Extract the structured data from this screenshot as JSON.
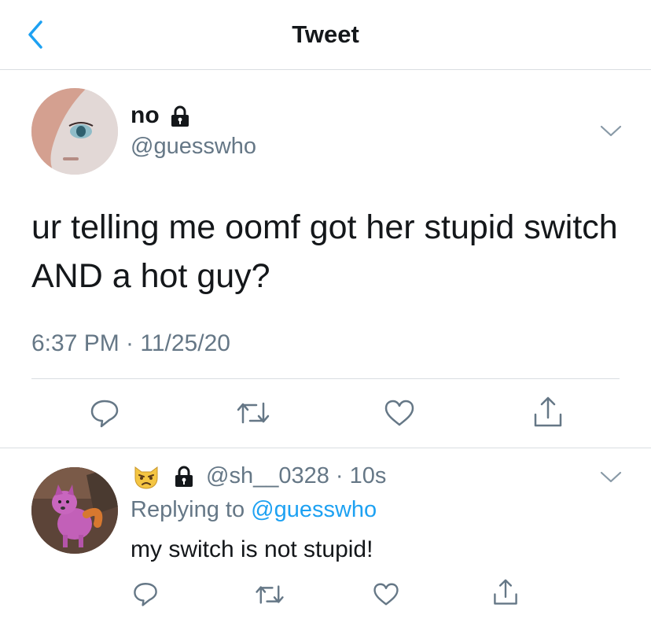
{
  "header": {
    "title": "Tweet",
    "back_icon": "chevron-left-icon",
    "accent": "#1da1f2"
  },
  "tweet": {
    "display_name": "no",
    "handle": "@guesswho",
    "text": "ur telling me oomf got her stupid switch AND a hot guy?",
    "timestamp": "6:37 PM · 11/25/20",
    "protected_icon": "lock-icon",
    "actions": [
      "reply-icon",
      "retweet-icon",
      "like-icon",
      "share-icon"
    ]
  },
  "reply": {
    "emoji": "😾",
    "handle": "@sh__0328",
    "separator": "·",
    "time": "10s",
    "replying_prefix": "Replying to",
    "replying_to": "@guesswho",
    "text": "my switch is not stupid!",
    "actions": [
      "reply-icon",
      "retweet-icon",
      "like-icon",
      "share-icon"
    ]
  },
  "colors": {
    "text_primary": "#14171a",
    "text_secondary": "#657786",
    "link": "#1da1f2",
    "divider": "#d9dde1"
  }
}
